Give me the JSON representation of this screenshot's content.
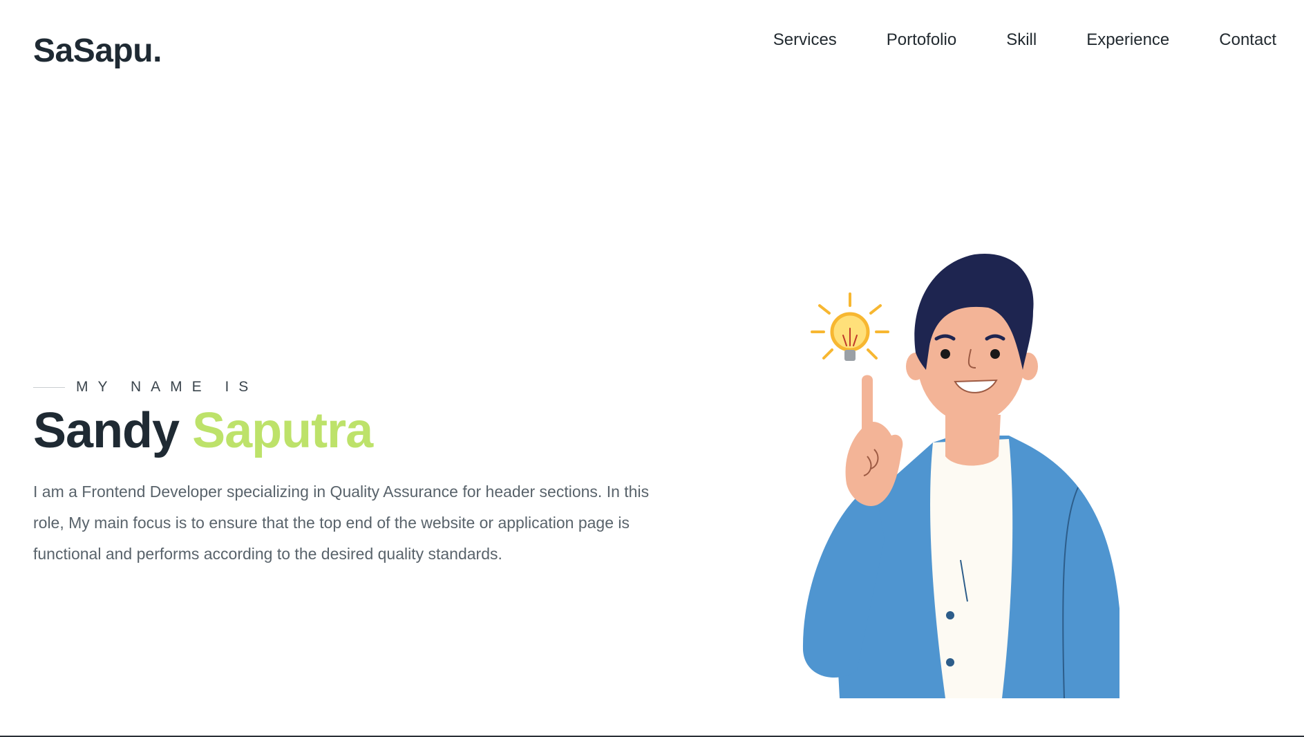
{
  "brand": {
    "logo": "SaSapu."
  },
  "nav": {
    "items": [
      {
        "label": "Services"
      },
      {
        "label": "Portofolio"
      },
      {
        "label": "Skill"
      },
      {
        "label": "Experience"
      },
      {
        "label": "Contact"
      }
    ]
  },
  "hero": {
    "eyebrow": "MY NAME IS",
    "first_name": "Sandy",
    "last_name": "Saputra",
    "bio": "I am a Frontend Developer specializing in Quality Assurance for header sections. In this role, My main focus is to ensure that the top end of the website or application page is functional and performs according to the desired quality standards."
  },
  "colors": {
    "accent": "#bde26a",
    "heading": "#1f2a33",
    "body_text": "#59636b",
    "jacket": "#4f95d0",
    "hair": "#1e2550",
    "skin": "#f3b497",
    "bulb": "#f7b731"
  },
  "illustration": {
    "icon": "developer-lightbulb-illustration"
  }
}
